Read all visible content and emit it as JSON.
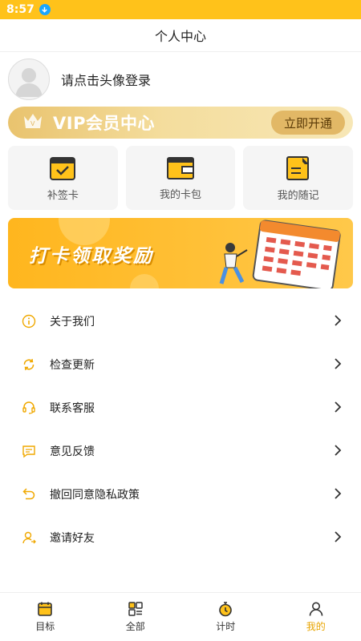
{
  "status_bar": {
    "time": "8:57"
  },
  "header": {
    "title": "个人中心"
  },
  "profile": {
    "login_prompt": "请点击头像登录"
  },
  "vip": {
    "title": "VIP会员中心",
    "button": "立即开通"
  },
  "tiles": [
    {
      "label": "补签卡"
    },
    {
      "label": "我的卡包"
    },
    {
      "label": "我的随记"
    }
  ],
  "banner": {
    "text": "打卡领取奖励"
  },
  "menu": [
    {
      "label": "关于我们",
      "icon": "info-icon"
    },
    {
      "label": "检查更新",
      "icon": "refresh-icon"
    },
    {
      "label": "联系客服",
      "icon": "headset-icon"
    },
    {
      "label": "意见反馈",
      "icon": "message-icon"
    },
    {
      "label": "撤回同意隐私政策",
      "icon": "undo-icon"
    },
    {
      "label": "邀请好友",
      "icon": "invite-user-icon"
    }
  ],
  "tabbar": [
    {
      "label": "目标",
      "icon": "calendar-icon"
    },
    {
      "label": "全部",
      "icon": "grid-icon"
    },
    {
      "label": "计时",
      "icon": "stopwatch-icon"
    },
    {
      "label": "我的",
      "icon": "user-icon",
      "active": true
    }
  ],
  "colors": {
    "accent": "#FFC21A",
    "active_tab": "#E8A400",
    "vip_gold": "#e9c36e"
  }
}
